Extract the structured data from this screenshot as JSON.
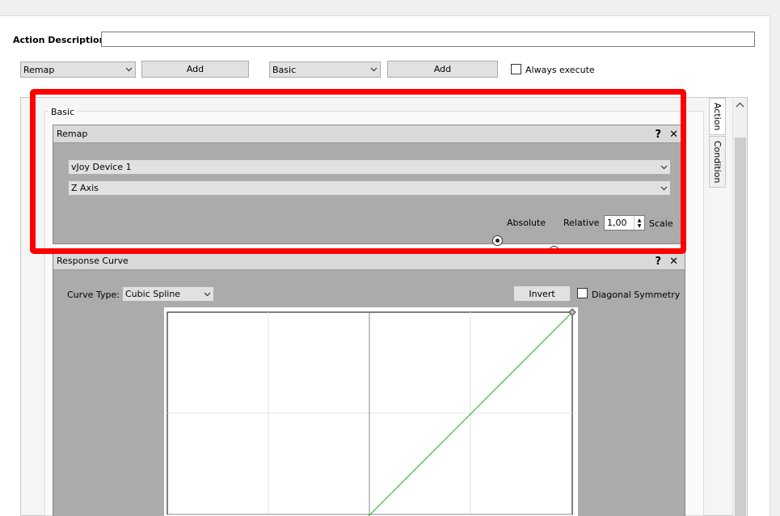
{
  "action_description": {
    "label": "Action Description",
    "value": ""
  },
  "toolbar": {
    "action_combo": "Remap",
    "add_action_label": "Add",
    "condition_combo": "Basic",
    "add_condition_label": "Add",
    "always_execute_label": "Always execute"
  },
  "group": {
    "title": "Basic"
  },
  "side_tabs": {
    "action": "Action",
    "condition": "Condition"
  },
  "remap": {
    "title": "Remap",
    "help_icon": "?",
    "close_icon": "✕",
    "device": "vJoy Device 1",
    "axis": "Z Axis",
    "absolute_label": "Absolute",
    "relative_label": "Relative",
    "scale_value": "1,00",
    "scale_label": "Scale",
    "mode_selected": "Absolute"
  },
  "response_curve": {
    "title": "Response Curve",
    "help_icon": "?",
    "close_icon": "✕",
    "curve_type_label": "Curve Type:",
    "curve_type": "Cubic Spline",
    "invert_label": "Invert",
    "diagonal_symmetry_label": "Diagonal Symmetry"
  },
  "icons": {
    "chevron": "chevron-down-icon",
    "help": "help-icon",
    "close": "close-icon",
    "scroll_up": "chevron-up-icon"
  },
  "colors": {
    "highlight": "#ff0000",
    "curve_line": "#22aa22",
    "panel_bg": "#ababab",
    "header_bg": "#d9d9d9"
  }
}
